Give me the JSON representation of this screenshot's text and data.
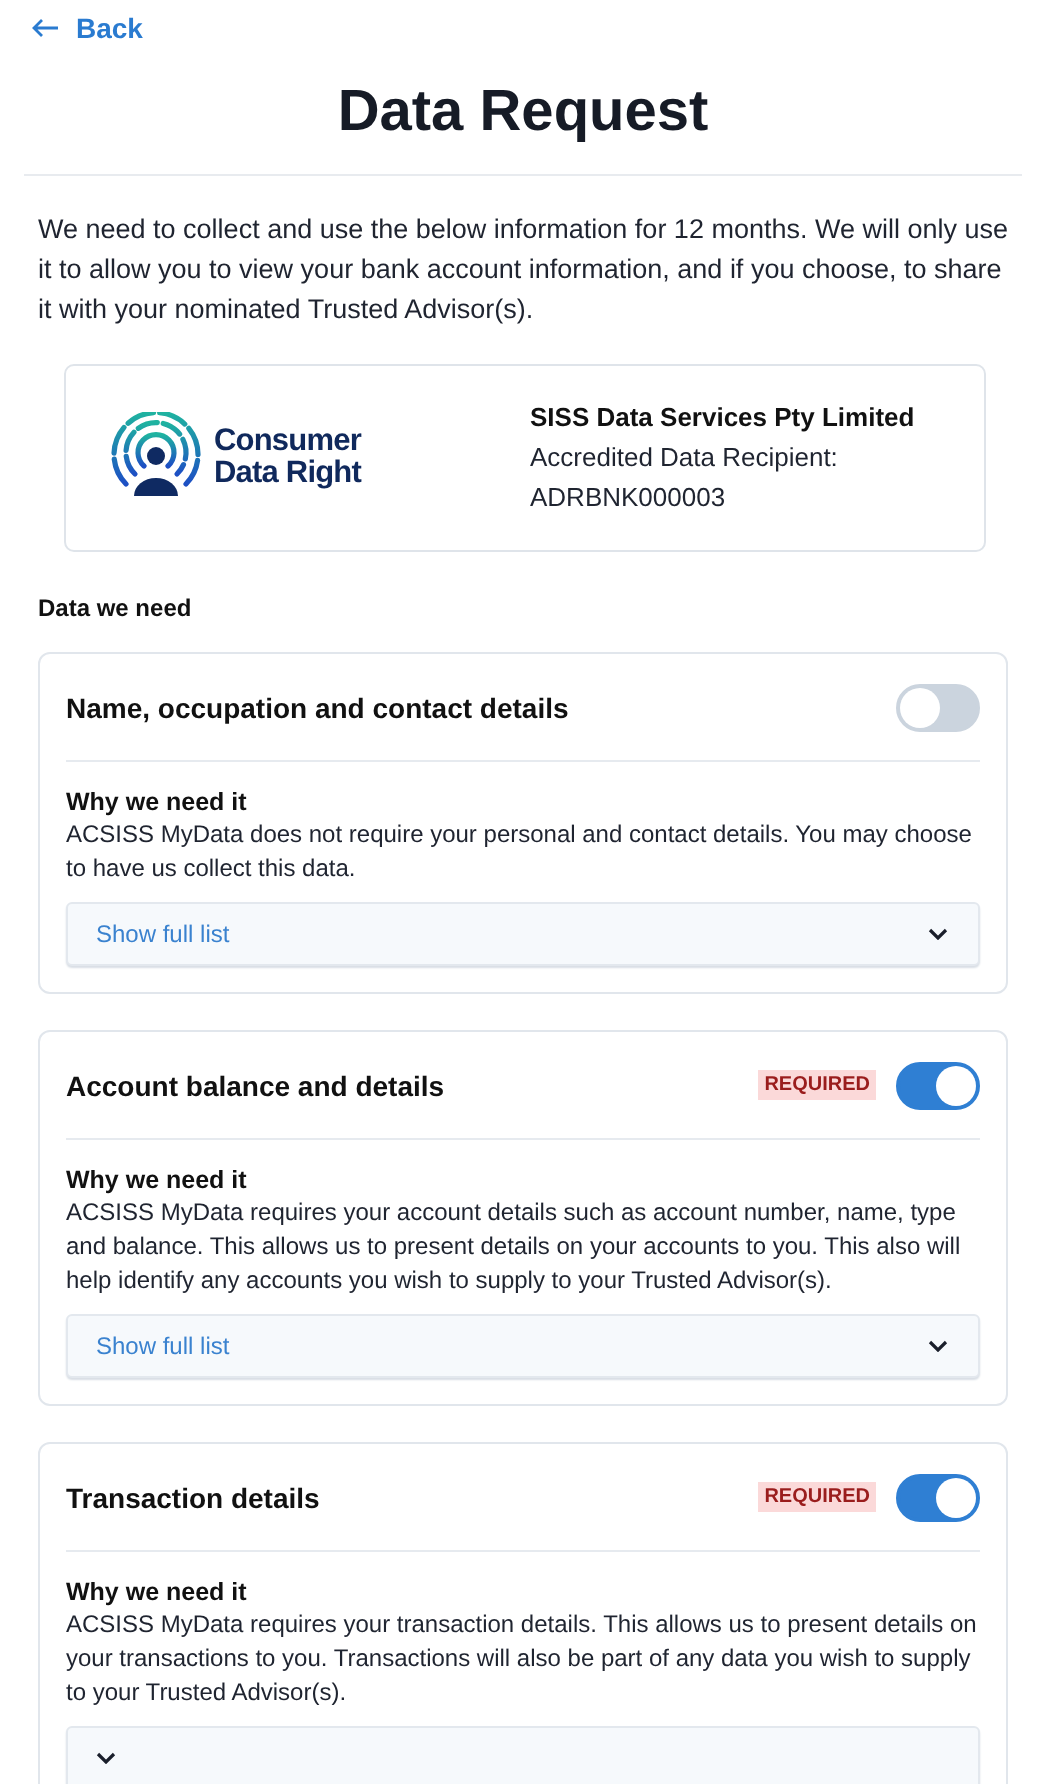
{
  "back": {
    "label": "Back"
  },
  "title": "Data Request",
  "intro": "We need to collect and use the below information for 12 months. We will only use it to allow you to view your bank account information, and if you choose, to share it with your nominated Trusted Advisor(s).",
  "recipient": {
    "logo_lines": [
      "Consumer",
      "Data Right"
    ],
    "name": "SISS Data Services Pty Limited",
    "role": "Accredited Data Recipient:",
    "id": "ADRBNK000003"
  },
  "section_label": "Data we need",
  "permissions": [
    {
      "title": "Name, occupation and contact details",
      "on": false,
      "why_heading": "Why we need it",
      "why_text": "ACSISS MyData does not require your personal and contact details. You may choose to have us collect this data.",
      "expander": {
        "label": "Show full list",
        "expanded": false
      }
    },
    {
      "title": "Account balance and details",
      "badge": "REQUIRED",
      "on": true,
      "why_heading": "Why we need it",
      "why_text": "ACSISS MyData requires your account details such as account number, name, type and balance. This allows us to present details on your accounts to you. This also will help identify any accounts you wish to supply to your Trusted Advisor(s).",
      "expander": {
        "label": "Show full list",
        "expanded": false
      }
    },
    {
      "title": "Transaction details",
      "badge": "REQUIRED",
      "on": true,
      "why_heading": "Why we need it",
      "why_text": "ACSISS MyData requires your transaction details. This allows us to present details on your transactions to you. Transactions will also be part of any data you wish to supply to your Trusted Advisor(s).",
      "expander": {
        "expanded": false
      }
    }
  ]
}
